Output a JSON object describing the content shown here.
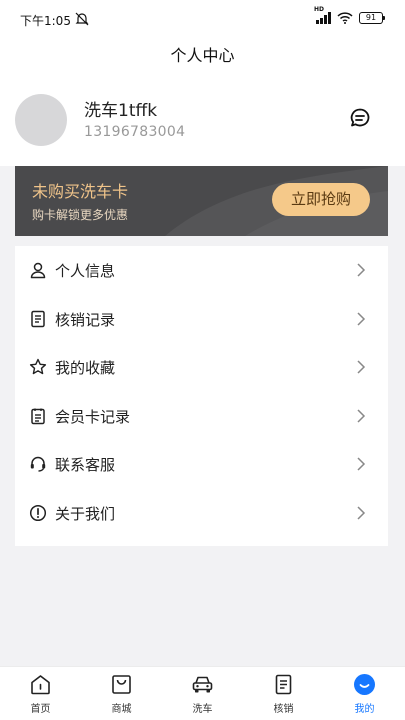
{
  "status_bar": {
    "time": "下午1:05",
    "network": "HD",
    "battery": "91"
  },
  "header": {
    "title": "个人中心"
  },
  "profile": {
    "name": "洗车1tffk",
    "phone": "13196783004"
  },
  "banner": {
    "title": "未购买洗车卡",
    "subtitle": "购卡解锁更多优惠",
    "button": "立即抢购"
  },
  "menu": [
    {
      "label": "个人信息",
      "icon": "person-icon"
    },
    {
      "label": "核销记录",
      "icon": "document-icon"
    },
    {
      "label": "我的收藏",
      "icon": "star-icon"
    },
    {
      "label": "会员卡记录",
      "icon": "card-record-icon"
    },
    {
      "label": "联系客服",
      "icon": "headset-icon"
    },
    {
      "label": "关于我们",
      "icon": "info-icon"
    }
  ],
  "tabbar": [
    {
      "label": "首页",
      "icon": "home-icon"
    },
    {
      "label": "商城",
      "icon": "shopping-bag-icon"
    },
    {
      "label": "洗车",
      "icon": "car-icon"
    },
    {
      "label": "核销",
      "icon": "document-icon"
    },
    {
      "label": "我的",
      "icon": "profile-smile-icon",
      "active": true
    }
  ],
  "colors": {
    "accent": "#1677ff",
    "banner_bg": "#4a4a4c",
    "banner_title": "#f0c48a",
    "banner_button": "#f5c98a"
  }
}
